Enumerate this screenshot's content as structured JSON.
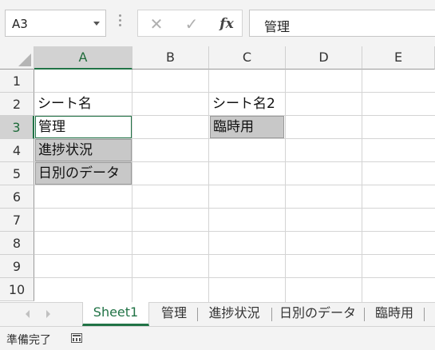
{
  "formula_bar": {
    "name_box": "A3",
    "cancel_glyph": "✕",
    "enter_glyph": "✓",
    "fx_label": "fx",
    "content": "管理"
  },
  "columns": [
    "A",
    "B",
    "C",
    "D",
    "E"
  ],
  "selected_column": "A",
  "rows": [
    "1",
    "2",
    "3",
    "4",
    "5",
    "6",
    "7",
    "8",
    "9",
    "10"
  ],
  "selected_row": "3",
  "cells": {
    "A2": "シート名",
    "A3": "管理",
    "A4": "進捗状況",
    "A5": "日別のデータ",
    "C2": "シート名2",
    "C3": "臨時用"
  },
  "sheet_tabs": [
    "Sheet1",
    "管理",
    "進捗状況",
    "日別のデータ",
    "臨時用"
  ],
  "active_tab": "Sheet1",
  "status": {
    "ready_text": "準備完了"
  },
  "colors": {
    "accent": "#217346",
    "filled_cell": "#c8c8c8"
  }
}
